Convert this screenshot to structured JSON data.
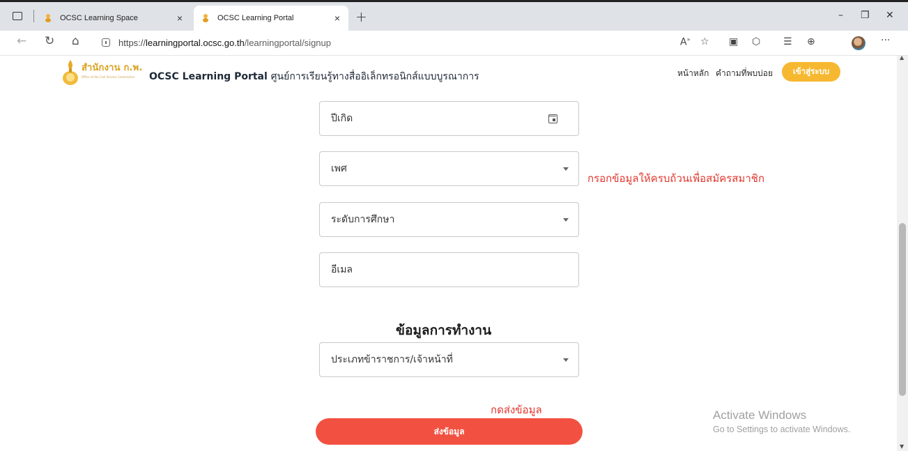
{
  "browser": {
    "tabs": [
      {
        "label": "OCSC Learning Space",
        "close": "×",
        "active": false
      },
      {
        "label": "OCSC Learning Portal",
        "close": "×",
        "active": true
      }
    ],
    "new_tab": "+",
    "window_controls": {
      "minimize": "–",
      "restore": "❐",
      "close": "✕"
    },
    "url": {
      "prefix": "https://",
      "host": "learningportal.ocsc.go.th",
      "path": "/learningportal/signup"
    },
    "toolbar_icons": [
      "read-aloud-icon",
      "favorite-add-icon",
      "reading-view-icon",
      "extensions-icon",
      "favorites-icon",
      "collections-icon",
      "profile-avatar",
      "more-icon"
    ]
  },
  "header": {
    "logo_th": "สำนักงาน ก.พ.",
    "logo_en": "Office of the Civil Service Commission",
    "title_en": "OCSC Learning Portal",
    "title_th": "ศูนย์การเรียนรู้ทางสื่ออิเล็กทรอนิกส์แบบบูรณาการ",
    "nav": [
      "หน้าหลัก",
      "คำถามที่พบบ่อย"
    ],
    "login_label": "เข้าสู่ระบบ"
  },
  "form": {
    "birth_year": "ปีเกิด",
    "gender": "เพศ",
    "education": "ระดับการศึกษา",
    "email": "อีเมล",
    "work_section_title": "ข้อมูลการทำงาน",
    "officer_type": "ประเภทข้าราชการ/เจ้าหน้าที่",
    "submit_label": "ส่งข้อมูล"
  },
  "annotations": {
    "fill_all": "กรอกข้อมูลให้ครบถ้วนเพื่อสมัครสมาชิก",
    "press_submit": "กดส่งข้อมูล"
  },
  "watermark": {
    "line1": "Activate Windows",
    "line2": "Go to Settings to activate Windows."
  }
}
